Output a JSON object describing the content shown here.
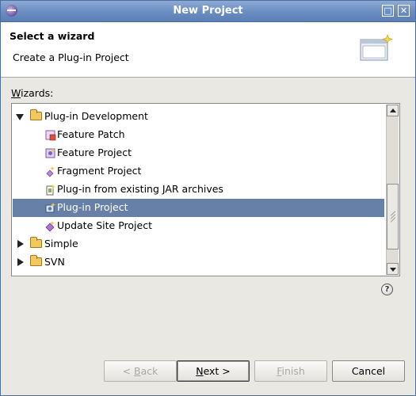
{
  "window": {
    "title": "New Project",
    "maximize_glyph": "□",
    "close_glyph": "✕"
  },
  "header": {
    "title": "Select a wizard",
    "description": "Create a Plug-in Project"
  },
  "wizards": {
    "label_mnemonic": "W",
    "label_rest": "izards:",
    "tree": [
      {
        "label": "Plug-in Development",
        "type": "folder",
        "expanded": true,
        "selected": false,
        "icon": "folder-open-icon"
      },
      {
        "label": "Feature Patch",
        "type": "item",
        "selected": false,
        "icon": "feature-patch-icon"
      },
      {
        "label": "Feature Project",
        "type": "item",
        "selected": false,
        "icon": "feature-project-icon"
      },
      {
        "label": "Fragment Project",
        "type": "item",
        "selected": false,
        "icon": "fragment-icon"
      },
      {
        "label": "Plug-in from existing JAR archives",
        "type": "item",
        "selected": false,
        "icon": "jar-plugin-icon"
      },
      {
        "label": "Plug-in Project",
        "type": "item",
        "selected": true,
        "icon": "plugin-project-icon"
      },
      {
        "label": "Update Site Project",
        "type": "item",
        "selected": false,
        "icon": "update-site-icon"
      },
      {
        "label": "Simple",
        "type": "folder",
        "expanded": false,
        "selected": false,
        "icon": "folder-icon"
      },
      {
        "label": "SVN",
        "type": "folder",
        "expanded": false,
        "selected": false,
        "icon": "folder-icon"
      }
    ]
  },
  "help": {
    "glyph": "?"
  },
  "buttons": {
    "back_prefix": "< ",
    "back_mnemonic": "B",
    "back_rest": "ack",
    "next_mnemonic": "N",
    "next_rest": "ext >",
    "finish_mnemonic": "F",
    "finish_rest": "inish",
    "cancel_label": "Cancel"
  },
  "colors": {
    "selection": "#6780a8",
    "titlebar": "#6c8fc3",
    "header_bg": "#ffffff"
  }
}
